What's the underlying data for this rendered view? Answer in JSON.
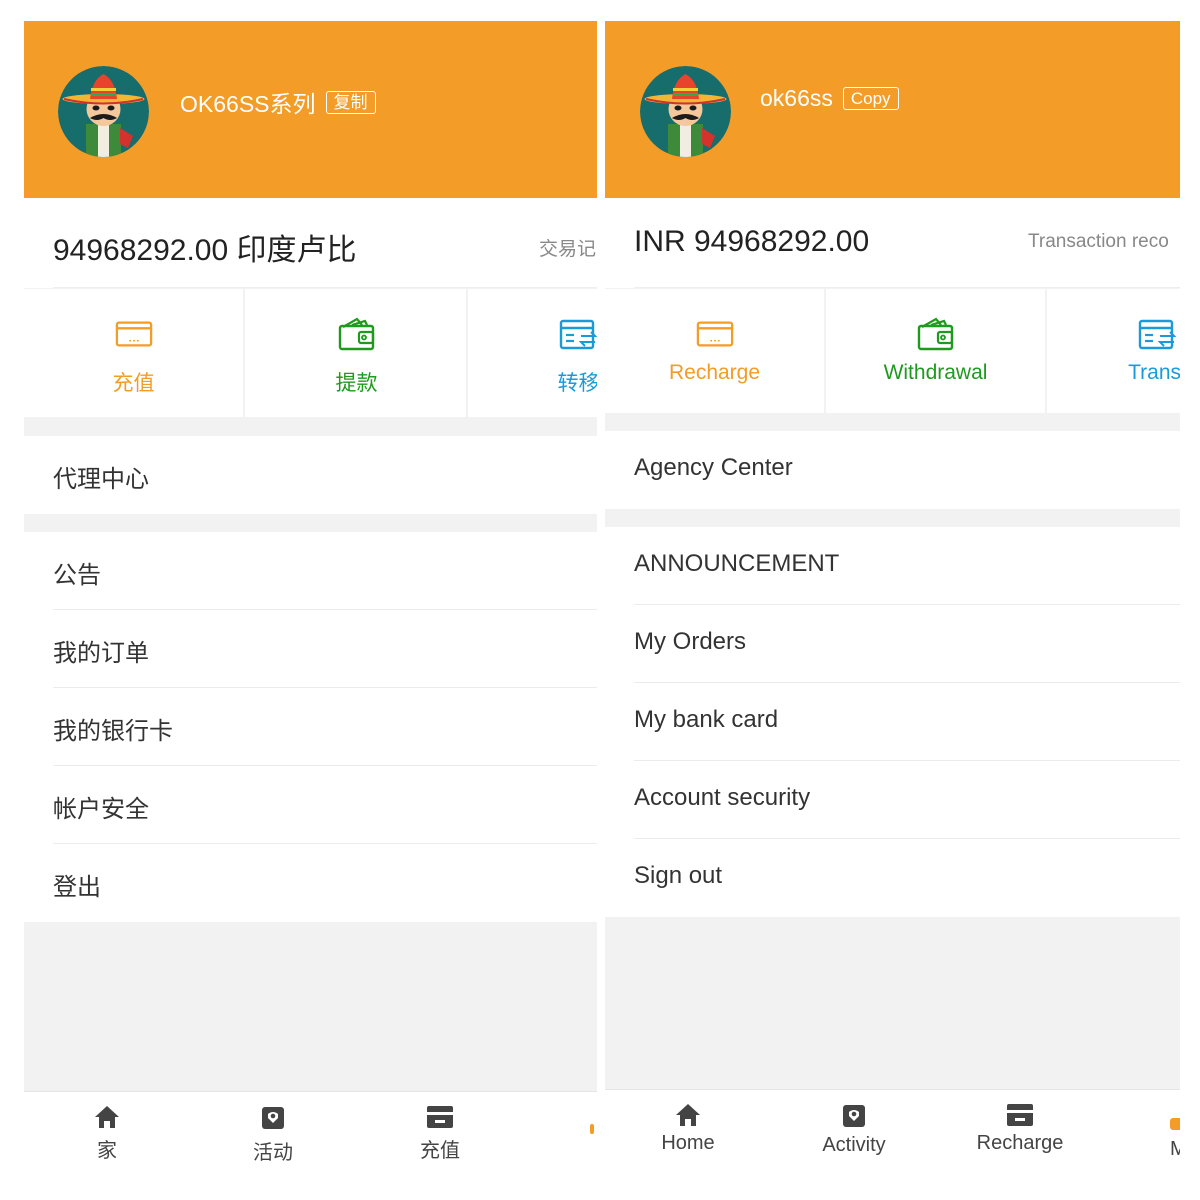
{
  "colors": {
    "accent": "#f39c27",
    "orange": "#f39c27",
    "green": "#1e9a1e",
    "blue": "#1a9ad8"
  },
  "left": {
    "username": "OK66SS系列",
    "copy_label": "复制",
    "balance": "94968292.00 印度卢比",
    "records_label": "交易记",
    "actions": [
      {
        "label": "充值",
        "icon": "card-icon"
      },
      {
        "label": "提款",
        "icon": "wallet-icon"
      },
      {
        "label": "转移",
        "icon": "transfer-icon"
      }
    ],
    "agency": "代理中心",
    "menu": [
      "公告",
      "我的订单",
      "我的银行卡",
      "帐户安全",
      "登出"
    ],
    "tabs": [
      {
        "label": "家",
        "icon": "home-icon"
      },
      {
        "label": "活动",
        "icon": "activity-icon"
      },
      {
        "label": "充值",
        "icon": "recharge-icon"
      }
    ]
  },
  "right": {
    "username": "ok66ss",
    "copy_label": "Copy",
    "balance": "INR 94968292.00",
    "records_label": "Transaction reco",
    "actions": [
      {
        "label": "Recharge",
        "icon": "card-icon"
      },
      {
        "label": "Withdrawal",
        "icon": "wallet-icon"
      },
      {
        "label": "Transf",
        "icon": "transfer-icon"
      }
    ],
    "agency": "Agency Center",
    "menu": [
      "ANNOUNCEMENT",
      "My Orders",
      "My bank card",
      "Account security",
      "Sign out"
    ],
    "tabs": [
      {
        "label": "Home",
        "icon": "home-icon"
      },
      {
        "label": "Activity",
        "icon": "activity-icon"
      },
      {
        "label": "Recharge",
        "icon": "recharge-icon"
      },
      {
        "label": "M",
        "icon": "mine-icon"
      }
    ]
  }
}
